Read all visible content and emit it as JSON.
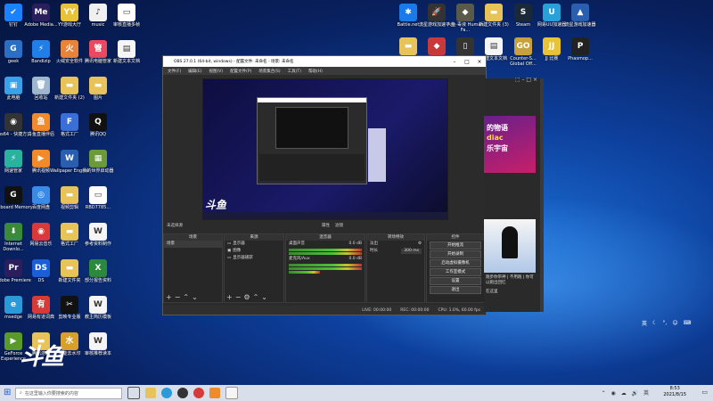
{
  "desktop": {
    "left_icons": [
      {
        "label": "钉钉",
        "color": "#1a82ff",
        "glyph": "✔"
      },
      {
        "label": "Adobe Media...",
        "color": "#2b1e5c",
        "glyph": "Me"
      },
      {
        "label": "YY游戏大厅",
        "color": "#e8c33a",
        "glyph": "YY"
      },
      {
        "label": "music",
        "color": "#f0f0f0",
        "glyph": "♪"
      },
      {
        "label": "审核直播多帧",
        "color": "#fff",
        "glyph": "▭"
      },
      {
        "label": "geek",
        "color": "#2a6fc4",
        "glyph": "G"
      },
      {
        "label": "Bandizip",
        "color": "#1f7ee8",
        "glyph": "⚡"
      },
      {
        "label": "火绒安全软件",
        "color": "#e8833a",
        "glyph": "火"
      },
      {
        "label": "腾讯电脑管家",
        "color": "#e84a5f",
        "glyph": "管"
      },
      {
        "label": "新建文本文档",
        "color": "#f5f5f5",
        "glyph": "▤"
      },
      {
        "label": "此电脑",
        "color": "#3aa0e8",
        "glyph": "▣"
      },
      {
        "label": "回收站",
        "color": "#9fb6cf",
        "glyph": "🗑"
      },
      {
        "label": "新建文件夹 (2)",
        "color": "#e8c35a",
        "glyph": "▬"
      },
      {
        "label": "图片",
        "color": "#e8c35a",
        "glyph": "▬"
      },
      {
        "label": "obs64 - 快捷方式",
        "color": "#333",
        "glyph": "◉"
      },
      {
        "label": "斗鱼直播伴侣",
        "color": "#f08a2b",
        "glyph": "鱼"
      },
      {
        "label": "格式工厂",
        "color": "#3a6fd8",
        "glyph": "F"
      },
      {
        "label": "腾讯QQ",
        "color": "#111",
        "glyph": "Q"
      },
      {
        "label": "网速管家",
        "color": "#2ab1a0",
        "glyph": "⚡"
      },
      {
        "label": "腾讯视频",
        "color": "#f08a2b",
        "glyph": "▶"
      },
      {
        "label": "Wallpaper Engine",
        "color": "#2a5fb0",
        "glyph": "W"
      },
      {
        "label": "我的世界启动器",
        "color": "#6a9a3a",
        "glyph": "▦"
      },
      {
        "label": "Onboard Memory",
        "color": "#111",
        "glyph": "G"
      },
      {
        "label": "百度网盘",
        "color": "#3a8ae8",
        "glyph": "◎"
      },
      {
        "label": "视频剪辑",
        "color": "#e8c35a",
        "glyph": "▬"
      },
      {
        "label": "RBD7785...",
        "color": "#fff",
        "glyph": "▭"
      },
      {
        "label": "Internet Downlo...",
        "color": "#3a8a3a",
        "glyph": "⬇"
      },
      {
        "label": "网易云音乐",
        "color": "#d83a3a",
        "glyph": "◉"
      },
      {
        "label": "格式工厂",
        "color": "#e8c35a",
        "glyph": "▬"
      },
      {
        "label": "参考资料制作",
        "color": "#f5f5f5",
        "glyph": "W"
      },
      {
        "label": "Adobe Premiere",
        "color": "#2b1e5c",
        "glyph": "Pr"
      },
      {
        "label": "DS",
        "color": "#1a5fd8",
        "glyph": "DS"
      },
      {
        "label": "新建文件夹",
        "color": "#e8c35a",
        "glyph": "▬"
      },
      {
        "label": "部分报告资料",
        "color": "#2a8a3a",
        "glyph": "X"
      },
      {
        "label": "msedge",
        "color": "#2a9ad8",
        "glyph": "e"
      },
      {
        "label": "网易有道词典",
        "color": "#d83a3a",
        "glyph": "有"
      },
      {
        "label": "剪映专业版",
        "color": "#111",
        "glyph": "✂"
      },
      {
        "label": "教主简历模板",
        "color": "#f5f5f5",
        "glyph": "W"
      },
      {
        "label": "GeForce Experience",
        "color": "#5a9a2a",
        "glyph": "▶"
      },
      {
        "label": "腾讯游戏",
        "color": "#e8c35a",
        "glyph": "▬"
      },
      {
        "label": "全能去水印",
        "color": "#d8a02a",
        "glyph": "水"
      },
      {
        "label": "审核推荐读本",
        "color": "#f5f5f5",
        "glyph": "W"
      }
    ],
    "right_icons": [
      {
        "label": "Battle.net",
        "color": "#1a7ae8",
        "glyph": "✱"
      },
      {
        "label": "流星游戏加速平台",
        "color": "#333",
        "glyph": "🚀"
      },
      {
        "label": "人鱼·毒液 Human Fa...",
        "color": "#5a5a4a",
        "glyph": "◆"
      },
      {
        "label": "新建文件夹 (3)",
        "color": "#e8c35a",
        "glyph": "▬"
      },
      {
        "label": "Steam",
        "color": "#1b2838",
        "glyph": "S"
      },
      {
        "label": "网易UU加速器",
        "color": "#2aa0d8",
        "glyph": "U"
      },
      {
        "label": "流星游戏加速器",
        "color": "#2a5fb0",
        "glyph": "▲"
      },
      {
        "label": "",
        "color": "#e8c35a",
        "glyph": "▬"
      },
      {
        "label": "",
        "color": "#c83a3a",
        "glyph": "◆"
      },
      {
        "label": "",
        "color": "#333",
        "glyph": "▯"
      },
      {
        "label": "新建文本文档",
        "color": "#f5f5f5",
        "glyph": "▤"
      },
      {
        "label": "Counter-S... Global Off...",
        "color": "#c8a040",
        "glyph": "GO"
      },
      {
        "label": "JJ 比赛",
        "color": "#e8c33a",
        "glyph": "JJ"
      },
      {
        "label": "Phasmop...",
        "color": "#222",
        "glyph": "P"
      }
    ]
  },
  "obs": {
    "title": "OBS 27.0.1 (64-bit, windows) - 配置文件: 未命名 - 场景: 未命名",
    "menu": [
      "文件(F)",
      "编辑(E)",
      "视图(V)",
      "配置文件(P)",
      "场景集合(S)",
      "工具(T)",
      "帮助(H)"
    ],
    "sources_bar": "未选择源",
    "mid_buttons": [
      "属性",
      "滤镜"
    ],
    "docks": {
      "scenes": {
        "title": "场景",
        "items": [
          "场景"
        ]
      },
      "sources": {
        "title": "来源",
        "items": [
          "显示器",
          "图像",
          "显示器捕获"
        ]
      },
      "mixer": {
        "title": "混音器",
        "items": [
          "桌面声音",
          "麦克风/Aux",
          "桌面音频"
        ],
        "levels": [
          "0.0 dB",
          "0.0 dB"
        ]
      },
      "transitions": {
        "title": "转场特效",
        "type": "淡出",
        "duration_label": "时长",
        "duration": "300 ms"
      },
      "controls": {
        "title": "控件",
        "buttons": [
          "开始推流",
          "开始录制",
          "启动虚拟摄像机",
          "工作室模式",
          "设置",
          "退出"
        ]
      }
    },
    "status": {
      "live": "LIVE: 00:00:00",
      "rec": "REC: 00:00:00",
      "cpu": "CPU: 1.0%, 60.00 fps"
    }
  },
  "right_panel": {
    "banner_text": [
      "的物语",
      "diac",
      "乐宇宙"
    ],
    "video_caption": "跑步你带神 | 不用跑 | 你可以跑出回忆",
    "small_text": "在这里"
  },
  "taskbar": {
    "search_placeholder": "在这里输入你要搜索的内容",
    "time": "8:53",
    "date": "2021/8/15",
    "ime": [
      "英",
      "汉",
      "拼"
    ]
  },
  "watermark": "斗鱼",
  "colors": {
    "accent": "#1b6fd6",
    "obs_bg": "#2b2b2b",
    "taskbar": "#d9dfea"
  }
}
